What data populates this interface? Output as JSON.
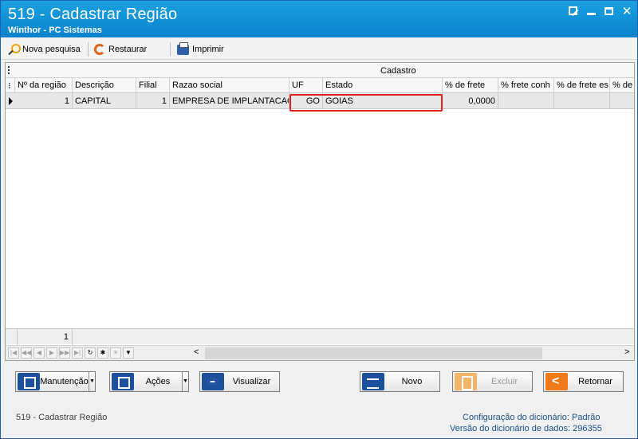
{
  "window": {
    "title": "519 - Cadastrar Região",
    "subtitle": "Winthor - PC Sistemas",
    "controls": {
      "restore": "",
      "minimize": "",
      "maximize": "",
      "close": "✕"
    }
  },
  "toolbar": {
    "nova_pesquisa": "Nova pesquisa",
    "restaurar": "Restaurar",
    "imprimir": "Imprimir"
  },
  "grid": {
    "band_title": "Cadastro",
    "columns": [
      "Nº da região",
      "Descrição",
      "Filial",
      "Razao social",
      "UF",
      "Estado",
      "% de frete",
      "% frete conh",
      "% de frete es",
      "% de"
    ],
    "rows": [
      {
        "regiao": "1",
        "descricao": "CAPITAL",
        "filial": "1",
        "razao_social": "EMPRESA DE IMPLANTACAO LT",
        "uf": "GO",
        "estado": "GOIAS",
        "frete": "0,0000",
        "frete_conh": "",
        "frete_es": "",
        "de": ""
      }
    ],
    "footer_count": "1"
  },
  "buttons": {
    "manutencao": "Manutenção",
    "acoes": "Ações",
    "visualizar": "Visualizar",
    "novo": "Novo",
    "excluir": "Excluir",
    "retornar": "Retornar"
  },
  "status": {
    "left": "519 - Cadastrar Região",
    "config_label": "Configuração do dicionário:",
    "config_value": "Padrão",
    "versao_label": "Versão do dicionário de dados:",
    "versao_value": "296355"
  },
  "colors": {
    "titlebar": "#0f8fd6",
    "highlight": "#e0201f",
    "status_text": "#1a4f8c"
  }
}
